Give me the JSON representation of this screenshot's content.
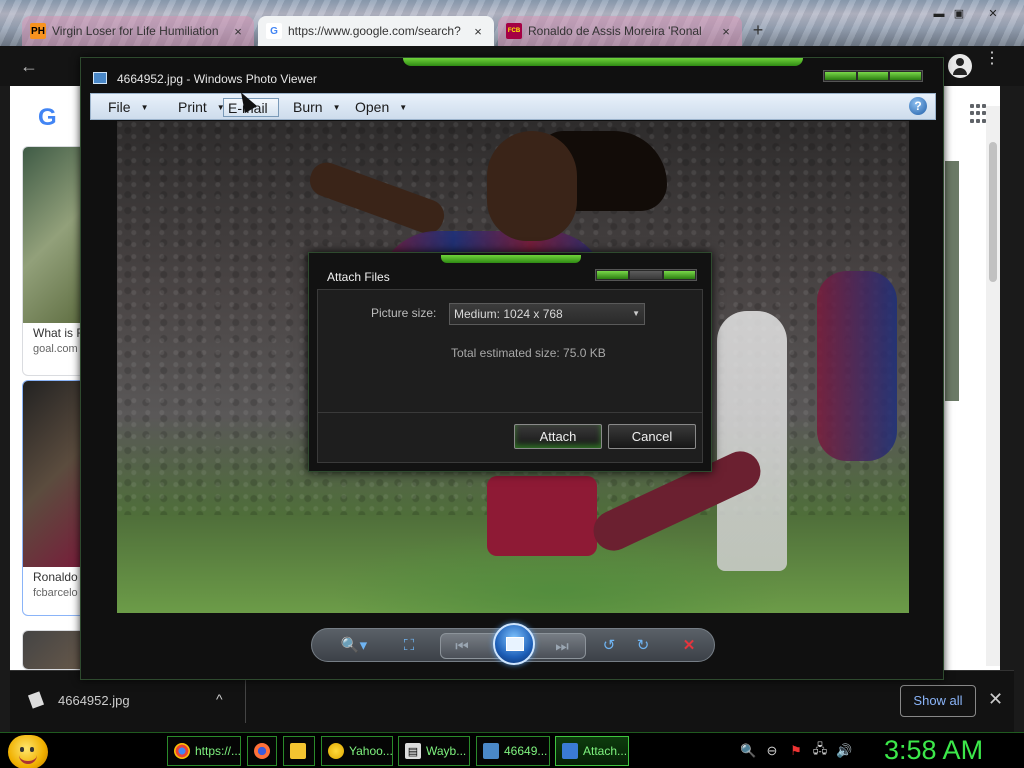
{
  "chrome": {
    "tabs": [
      {
        "favicon": "PH",
        "title": "Virgin Loser for Life Humiliation",
        "close": "×"
      },
      {
        "favicon": "G",
        "title": "https://www.google.com/search?",
        "close": "×"
      },
      {
        "favicon": "FCB",
        "title": "Ronaldo de Assis Moreira 'Ronal",
        "close": "×"
      }
    ],
    "new_tab": "+",
    "window_controls": {
      "minimize": "▬",
      "maximize": "▣",
      "close": "✕"
    },
    "back": "←",
    "menu": "⋮"
  },
  "google": {
    "logo": "G",
    "results": [
      {
        "title": "What is R",
        "source": "goal.com"
      },
      {
        "title": "Ronaldo",
        "source": "fcbarcelo"
      }
    ]
  },
  "download_bar": {
    "file_name": "4664952.jpg",
    "chevron": "^",
    "show_all": "Show all",
    "close": "✕"
  },
  "photo_viewer": {
    "title": "4664952.jpg - Windows Photo Viewer",
    "menu": [
      {
        "label": "File",
        "arrow": "▼"
      },
      {
        "label": "Print",
        "arrow": "▼"
      },
      {
        "label": "E-mail",
        "arrow": ""
      },
      {
        "label": "Burn",
        "arrow": "▼"
      },
      {
        "label": "Open",
        "arrow": "▼"
      }
    ],
    "help": "?",
    "toolbar": {
      "zoom": "🔍▾",
      "actual_size": "⛶",
      "previous": "⏮",
      "next": "⏭",
      "rotate_ccw": "↺",
      "rotate_cw": "↻",
      "delete": "✕"
    }
  },
  "attach_dialog": {
    "title": "Attach Files",
    "picture_size_label": "Picture size:",
    "picture_size_value": "Medium: 1024 x 768",
    "caret": "▼",
    "total_size": "Total estimated size: 75.0 KB",
    "attach_button": "Attach",
    "cancel_button": "Cancel"
  },
  "taskbar": {
    "buttons": [
      {
        "icon": "chrome-icon",
        "label": "https://..."
      },
      {
        "icon": "firefox-icon",
        "label": ""
      },
      {
        "icon": "folder-icon",
        "label": ""
      },
      {
        "icon": "yahoo-icon",
        "label": "Yahoo..."
      },
      {
        "icon": "wayback-icon",
        "label": "Wayb..."
      },
      {
        "icon": "photo-viewer-icon",
        "label": "46649..."
      },
      {
        "icon": "attach-icon",
        "label": "Attach..."
      }
    ],
    "tray": {
      "search": "🔍",
      "minus": "⊖",
      "flag": "⚑",
      "network": "🖧",
      "volume": "🔊"
    },
    "clock": "3:58 AM"
  },
  "colors": {
    "accent_green": "#3ce84a",
    "highlight_green": "#6fd33a",
    "link_blue": "#8ab4f8"
  }
}
